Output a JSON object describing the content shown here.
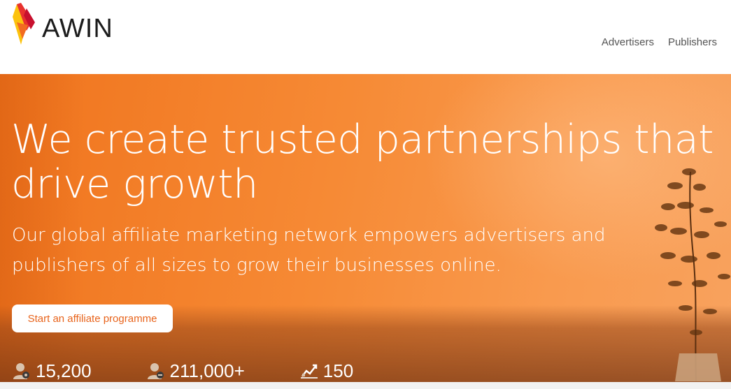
{
  "header": {
    "brand": "AWIN",
    "nav": [
      {
        "label": "Advertisers"
      },
      {
        "label": "Publishers"
      }
    ]
  },
  "hero": {
    "headline_line1": "We create trusted partnerships that",
    "headline_line2": "drive growth",
    "subhead_line1": "Our global affiliate marketing network empowers advertisers and",
    "subhead_line2": "publishers of all sizes to grow their businesses online.",
    "cta_label": "Start an affiliate programme"
  },
  "stats": [
    {
      "icon": "advertiser-person-icon",
      "value": "15,200"
    },
    {
      "icon": "publisher-person-icon",
      "value": "211,000+"
    },
    {
      "icon": "growth-chart-icon",
      "value": "150"
    }
  ],
  "colors": {
    "accent": "#f0741d",
    "cta_text": "#e8641c",
    "logo_red": "#e8322e",
    "logo_orange": "#f7941d",
    "logo_yellow": "#fcc20d"
  }
}
